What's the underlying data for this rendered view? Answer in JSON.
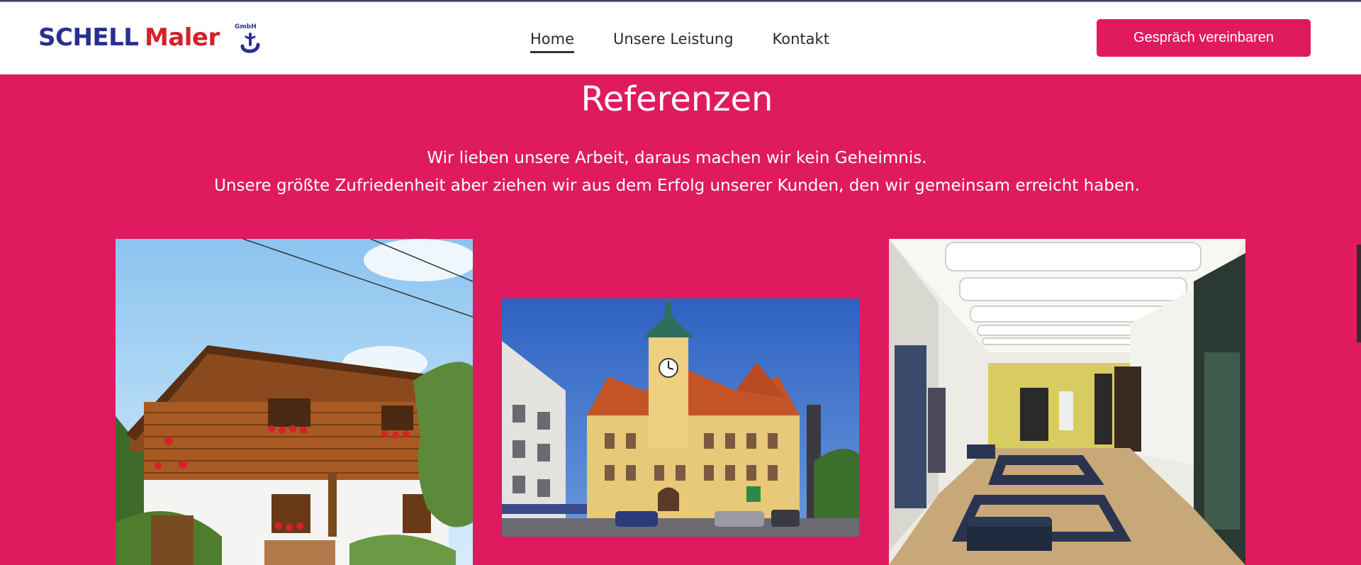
{
  "brand": {
    "name_part1": "SCHELL",
    "name_part2": "Maler",
    "suffix": "GmbH",
    "color_primary": "#2a2f8f",
    "color_secondary": "#d6202a"
  },
  "nav": {
    "items": [
      {
        "label": "Home",
        "active": true
      },
      {
        "label": "Unsere Leistung",
        "active": false
      },
      {
        "label": "Kontakt",
        "active": false
      }
    ]
  },
  "cta": {
    "label": "Gespräch vereinbaren"
  },
  "section": {
    "title": "Referenzen",
    "line1": "Wir lieben unsere Arbeit, daraus machen wir kein Geheimnis.",
    "line2": "Unsere größte Zufriedenheit aber ziehen wir aus dem Erfolg unserer Kunden, den wir gemeinsam erreicht haben."
  },
  "gallery": {
    "images": [
      {
        "name": "house-photo"
      },
      {
        "name": "town-hall-photo"
      },
      {
        "name": "hallway-photo"
      }
    ]
  },
  "colors": {
    "accent": "#e01a5f",
    "header_bg": "#ffffff",
    "text_dark": "#2a2a2a"
  }
}
